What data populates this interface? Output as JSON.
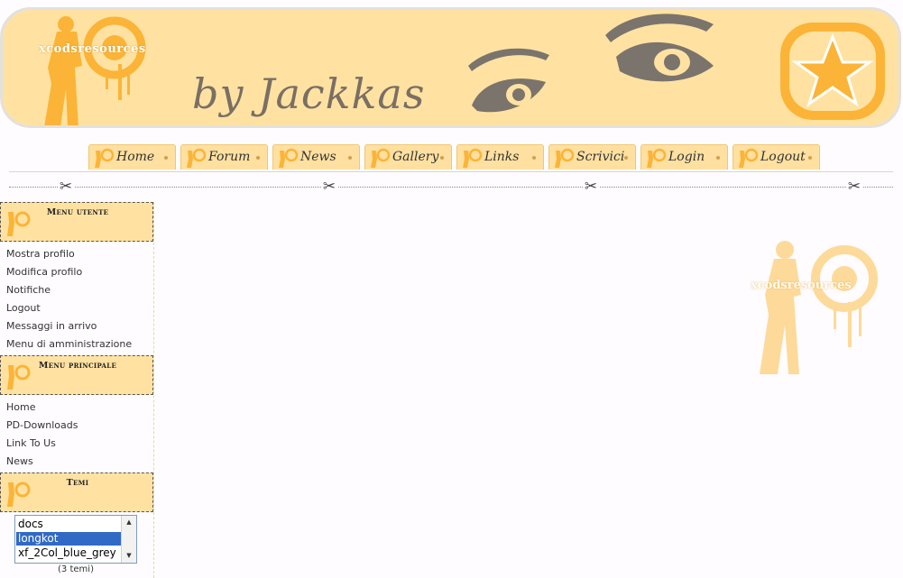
{
  "banner": {
    "logo_text": "xcodsresources",
    "title": "by Jackkas",
    "colors": {
      "background": "#ffe2a2",
      "accent": "#fbb437",
      "text": "#7a6f64"
    }
  },
  "nav": {
    "tabs": [
      {
        "label": "Home"
      },
      {
        "label": "Forum"
      },
      {
        "label": "News"
      },
      {
        "label": "Gallery"
      },
      {
        "label": "Links"
      },
      {
        "label": "Scrivici"
      },
      {
        "label": "Login"
      },
      {
        "label": "Logout"
      }
    ]
  },
  "sidebar": {
    "user_menu": {
      "title": "Menu utente",
      "items": [
        {
          "label": "Mostra profilo"
        },
        {
          "label": "Modifica profilo"
        },
        {
          "label": "Notifiche"
        },
        {
          "label": "Logout"
        },
        {
          "label": "Messaggi in arrivo"
        },
        {
          "label": "Menu di amministrazione"
        }
      ]
    },
    "main_menu": {
      "title": "Menu principale",
      "items": [
        {
          "label": "Home"
        },
        {
          "label": "PD-Downloads"
        },
        {
          "label": "Link To Us"
        },
        {
          "label": "News"
        }
      ]
    },
    "themes": {
      "title": "Temi",
      "options": [
        "docs",
        "longkot",
        "xf_2Col_blue_grey"
      ],
      "selected": "longkot",
      "count_text": "(3 temi)"
    }
  },
  "watermark": {
    "text": "xcodsresources"
  }
}
